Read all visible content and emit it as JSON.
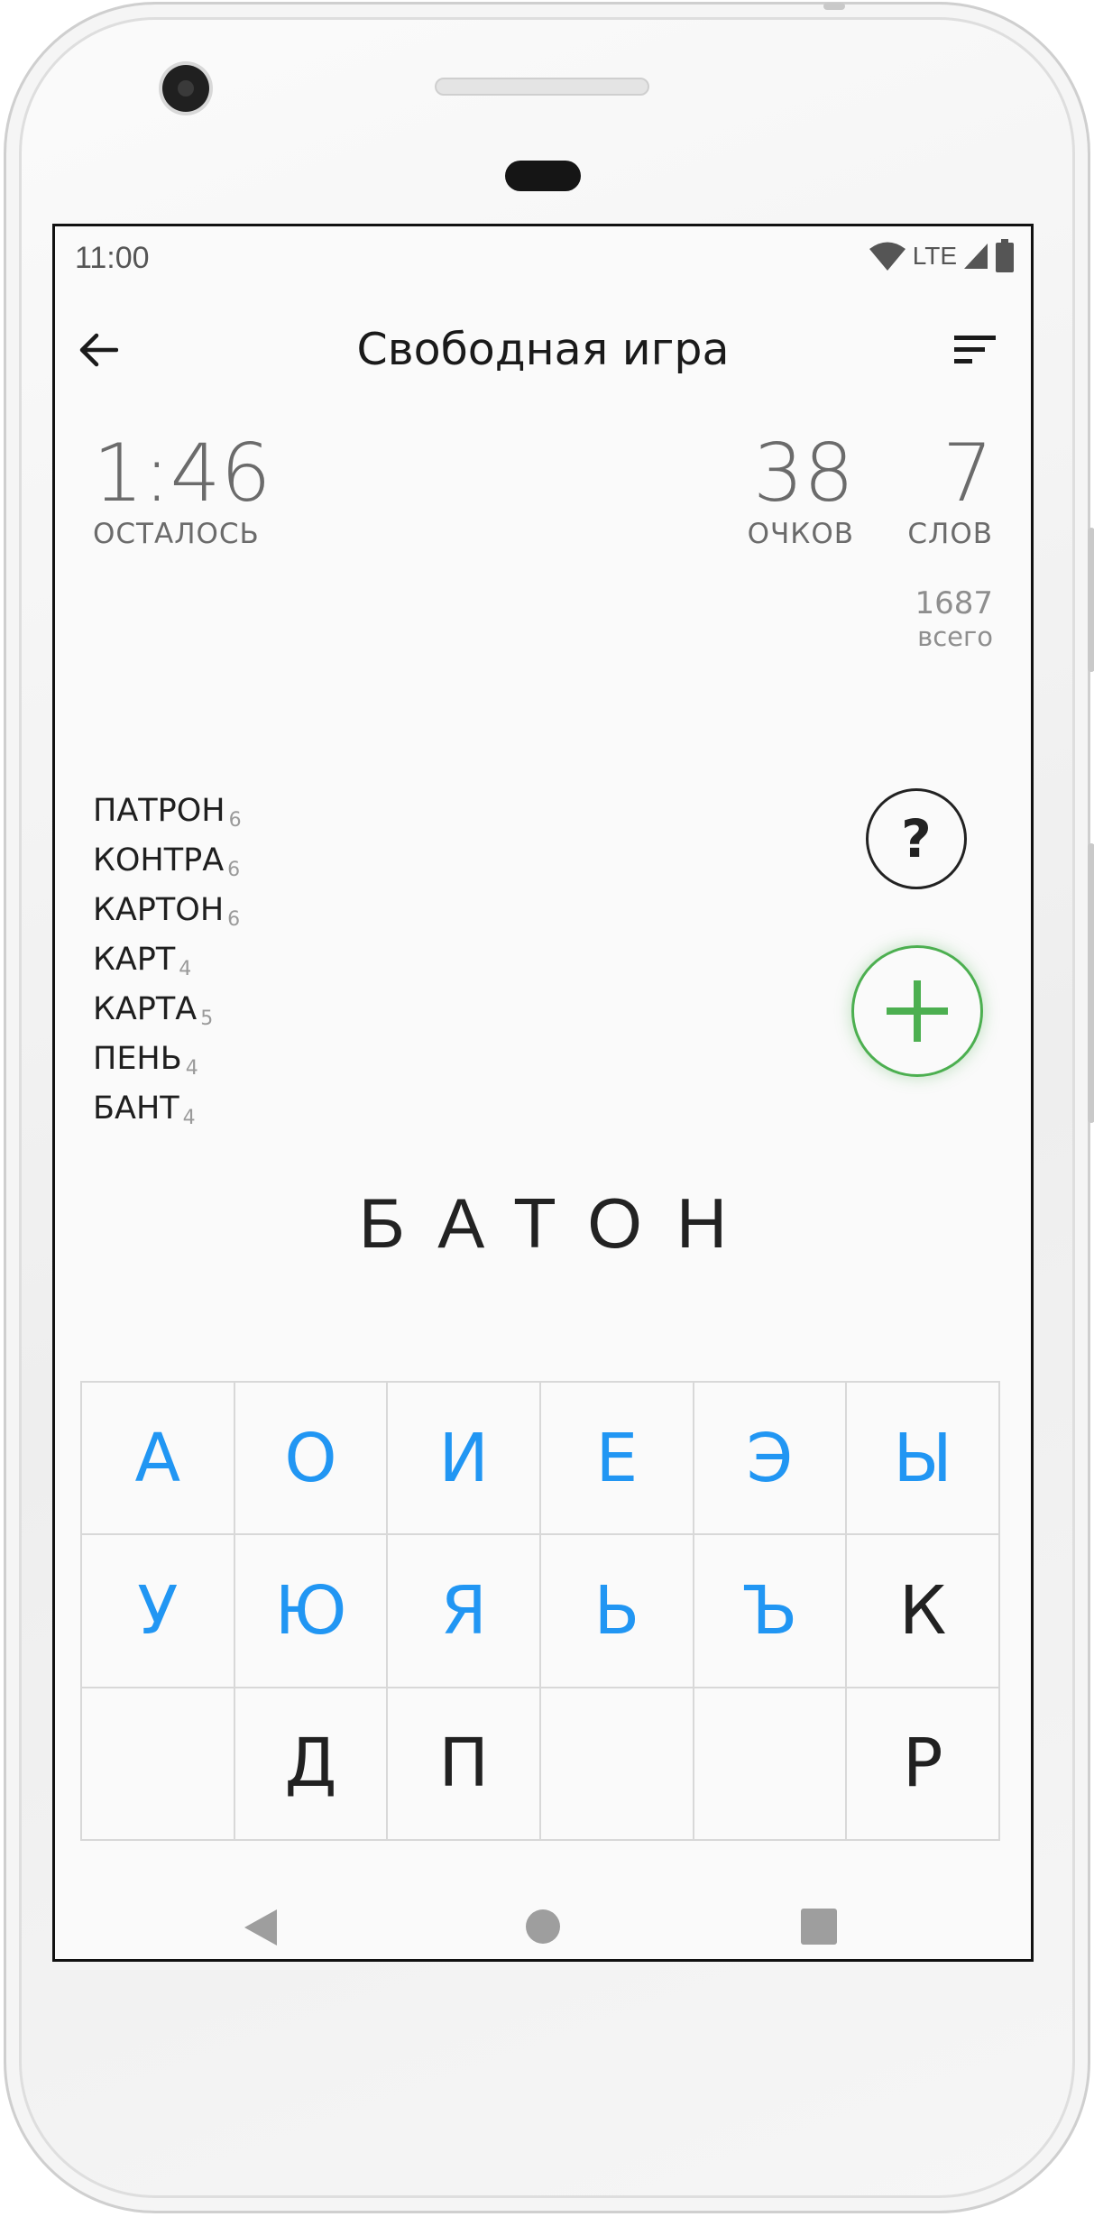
{
  "status_bar": {
    "time": "11:00",
    "network": "LTE"
  },
  "app_bar": {
    "title": "Свободная игра",
    "back_icon": "arrow-back-icon",
    "sort_icon": "sort-icon"
  },
  "stats": {
    "time_left": {
      "value": "1:46",
      "label": "ОСТАЛОСЬ"
    },
    "points": {
      "value": "38",
      "label": "ОЧКОВ"
    },
    "words": {
      "value": "7",
      "label": "СЛОВ"
    },
    "total": {
      "value": "1687",
      "label": "всего"
    }
  },
  "found_words": [
    {
      "word": "ПАТРОН",
      "score": "6"
    },
    {
      "word": "КОНТРА",
      "score": "6"
    },
    {
      "word": "КАРТОН",
      "score": "6"
    },
    {
      "word": "КАРТ",
      "score": "4"
    },
    {
      "word": "КАРТА",
      "score": "5"
    },
    {
      "word": "ПЕНЬ",
      "score": "4"
    },
    {
      "word": "БАНТ",
      "score": "4"
    }
  ],
  "buttons": {
    "help_label": "?",
    "add_icon": "plus-icon"
  },
  "current_word": "БАТОН",
  "colors": {
    "vowel": "#2196f3",
    "consonant": "#212121",
    "add_accent": "#4caf50"
  },
  "keyboard": {
    "rows": [
      [
        {
          "letter": "А",
          "kind": "vowel"
        },
        {
          "letter": "О",
          "kind": "vowel"
        },
        {
          "letter": "И",
          "kind": "vowel"
        },
        {
          "letter": "Е",
          "kind": "vowel"
        },
        {
          "letter": "Э",
          "kind": "vowel"
        },
        {
          "letter": "Ы",
          "kind": "vowel"
        }
      ],
      [
        {
          "letter": "У",
          "kind": "vowel"
        },
        {
          "letter": "Ю",
          "kind": "vowel"
        },
        {
          "letter": "Я",
          "kind": "vowel"
        },
        {
          "letter": "Ь",
          "kind": "vowel"
        },
        {
          "letter": "Ъ",
          "kind": "vowel"
        },
        {
          "letter": "К",
          "kind": "consonant"
        }
      ],
      [
        {
          "letter": "",
          "kind": "empty"
        },
        {
          "letter": "Д",
          "kind": "consonant"
        },
        {
          "letter": "П",
          "kind": "consonant"
        },
        {
          "letter": "",
          "kind": "empty"
        },
        {
          "letter": "",
          "kind": "empty"
        },
        {
          "letter": "Р",
          "kind": "consonant"
        }
      ]
    ]
  },
  "nav_bar": {
    "back": "nav-back-icon",
    "home": "nav-home-icon",
    "recents": "nav-recents-icon"
  }
}
